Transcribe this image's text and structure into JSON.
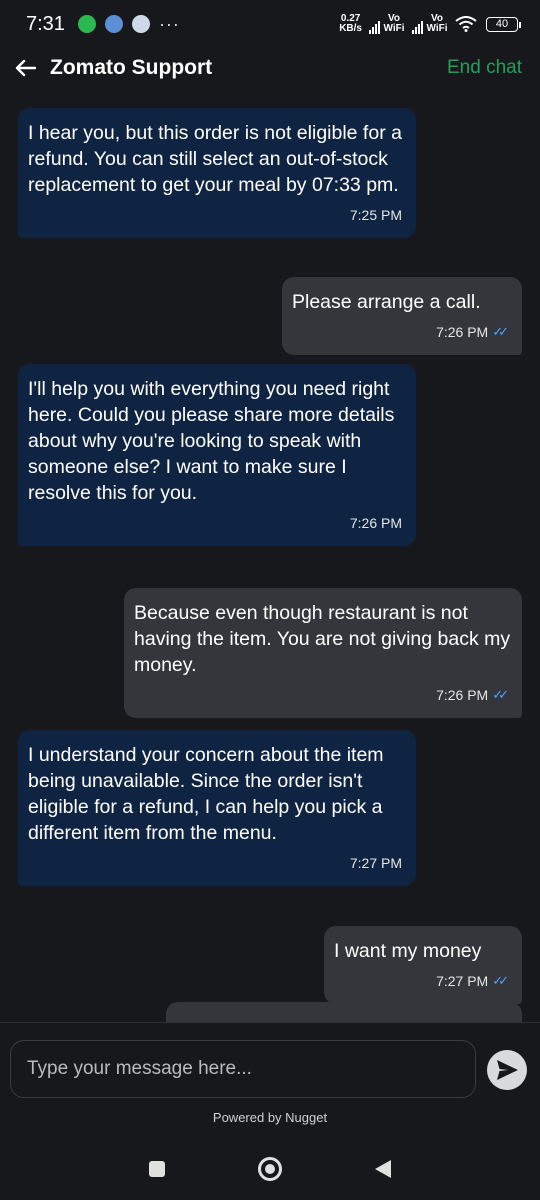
{
  "status_bar": {
    "time": "7:31",
    "speed_value": "0.27",
    "speed_unit": "KB/s",
    "net1_label": "Vo WiFi",
    "net2_label": "Vo WiFi",
    "battery": "40",
    "more": "···"
  },
  "header": {
    "title": "Zomato Support",
    "end_chat": "End chat"
  },
  "messages": [
    {
      "dir": "in",
      "text": "I hear you, but this order is not eligible for a refund. You can still select an out-of-stock replacement to get your meal by 07:33 pm.",
      "time": "7:25 PM"
    },
    {
      "dir": "out",
      "text": "Please arrange a call.",
      "time": "7:26 PM"
    },
    {
      "dir": "in",
      "text": "I'll help you with everything you need right here. Could you please share more details about why you're looking to speak with someone else? I want to make sure I resolve this for you.",
      "time": "7:26 PM"
    },
    {
      "dir": "out",
      "text": "Because even though restaurant is not having the item. You are not giving back my money.",
      "time": "7:26 PM"
    },
    {
      "dir": "in",
      "text": "I understand your concern about the item being unavailable. Since the order isn't eligible for a refund, I can help you pick a different item from the menu.",
      "time": "7:27 PM"
    },
    {
      "dir": "out",
      "text": "I want my money",
      "time": "7:27 PM"
    }
  ],
  "composer": {
    "placeholder": "Type your message here..."
  },
  "footer": {
    "powered_by": "Powered by Nugget"
  },
  "colors": {
    "background": "#17181b",
    "incoming_bubble": "#0f2442",
    "outgoing_bubble": "#34363b",
    "accent_green": "#22a05a",
    "read_ticks": "#4aa3ff"
  }
}
